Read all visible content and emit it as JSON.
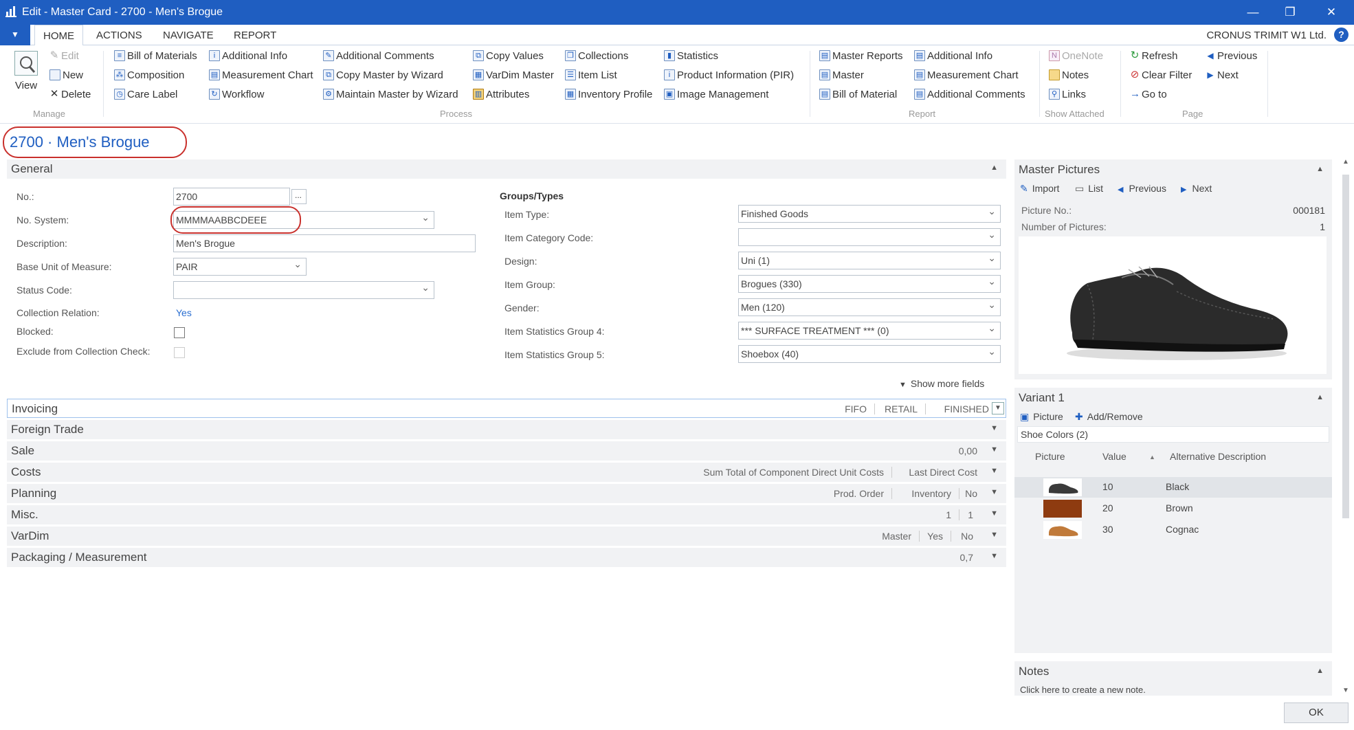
{
  "window": {
    "title": "Edit - Master Card - 2700 - Men's Brogue",
    "minimize": "—",
    "restore": "❐",
    "close": "✕"
  },
  "menu": {
    "file_glyph": "▼",
    "tabs": [
      "HOME",
      "ACTIONS",
      "NAVIGATE",
      "REPORT"
    ],
    "company": "CRONUS TRIMIT W1 Ltd.",
    "help": "?"
  },
  "ribbon": {
    "manage": {
      "view": "View",
      "edit": "Edit",
      "new": "New",
      "delete": "Delete",
      "label": "Manage"
    },
    "process": {
      "bill_of_materials": "Bill of Materials",
      "composition": "Composition",
      "care_label": "Care Label",
      "additional_info": "Additional Info",
      "measurement_chart": "Measurement Chart",
      "workflow": "Workflow",
      "additional_comments": "Additional Comments",
      "copy_master_wizard": "Copy Master by Wizard",
      "maintain_master_wizard": "Maintain Master by Wizard",
      "copy_values": "Copy Values",
      "vardim_master": "VarDim Master",
      "attributes": "Attributes",
      "collections": "Collections",
      "item_list": "Item List",
      "inventory_profile": "Inventory Profile",
      "statistics": "Statistics",
      "product_information": "Product Information (PIR)",
      "image_management": "Image Management",
      "label": "Process"
    },
    "report": {
      "master_reports": "Master Reports",
      "master": "Master",
      "bill_of_material": "Bill of Material",
      "additional_info": "Additional Info",
      "measurement_chart": "Measurement Chart",
      "additional_comments": "Additional Comments",
      "label": "Report"
    },
    "show_attached": {
      "onenote": "OneNote",
      "notes": "Notes",
      "links": "Links",
      "label": "Show Attached"
    },
    "page": {
      "refresh": "Refresh",
      "clear_filter": "Clear Filter",
      "go_to": "Go to",
      "previous": "Previous",
      "next": "Next",
      "label": "Page"
    }
  },
  "page_title": "2700 · Men's Brogue",
  "general": {
    "header": "General",
    "no_label": "No.:",
    "no_value": "2700",
    "assist": "...",
    "no_system_label": "No. System:",
    "no_system_value": "MMMMAABBCDEEE",
    "description_label": "Description:",
    "description_value": "Men's Brogue",
    "base_uom_label": "Base Unit of Measure:",
    "base_uom_value": "PAIR",
    "status_code_label": "Status Code:",
    "status_code_value": "",
    "collection_relation_label": "Collection Relation:",
    "collection_relation_value": "Yes",
    "blocked_label": "Blocked:",
    "blocked_checked": false,
    "exclude_label": "Exclude from Collection Check:",
    "exclude_checked": false,
    "groups_header": "Groups/Types",
    "item_type_label": "Item Type:",
    "item_type_value": "Finished Goods",
    "item_category_label": "Item Category Code:",
    "item_category_value": "",
    "design_label": "Design:",
    "design_value": "Uni (1)",
    "item_group_label": "Item Group:",
    "item_group_value": "Brogues (330)",
    "gender_label": "Gender:",
    "gender_value": "Men (120)",
    "stat4_label": "Item Statistics Group 4:",
    "stat4_value": "*** SURFACE TREATMENT *** (0)",
    "stat5_label": "Item Statistics Group 5:",
    "stat5_value": "Shoebox (40)",
    "show_more": "Show more fields"
  },
  "fasttabs": {
    "invoicing": {
      "label": "Invoicing",
      "v1": "FIFO",
      "v2": "RETAIL",
      "v3": "FINISHED"
    },
    "foreign_trade": {
      "label": "Foreign Trade"
    },
    "sale": {
      "label": "Sale",
      "v1": "0,00"
    },
    "costs": {
      "label": "Costs",
      "v1": "Sum Total of Component Direct Unit Costs",
      "v2": "Last Direct Cost"
    },
    "planning": {
      "label": "Planning",
      "v1": "Prod. Order",
      "v2": "Inventory",
      "v3": "No"
    },
    "misc": {
      "label": "Misc.",
      "v1": "1",
      "v2": "1"
    },
    "vardim": {
      "label": "VarDim",
      "v1": "Master",
      "v2": "Yes",
      "v3": "No"
    },
    "packaging": {
      "label": "Packaging / Measurement",
      "v1": "0,7"
    }
  },
  "master_pictures": {
    "header": "Master Pictures",
    "import": "Import",
    "list": "List",
    "previous": "Previous",
    "next": "Next",
    "picture_no_label": "Picture No.:",
    "picture_no_value": "000181",
    "number_label": "Number of Pictures:",
    "number_value": "1"
  },
  "variant": {
    "header": "Variant 1",
    "picture": "Picture",
    "add_remove": "Add/Remove",
    "group": "Shoe Colors (2)",
    "col_picture": "Picture",
    "col_value": "Value",
    "col_alt": "Alternative Description",
    "rows": [
      {
        "value": "10",
        "desc": "Black",
        "color": "#3a3a3a"
      },
      {
        "value": "20",
        "desc": "Brown",
        "color": "#8e3b10"
      },
      {
        "value": "30",
        "desc": "Cognac",
        "color": "#c07a3a"
      }
    ]
  },
  "notes": {
    "header": "Notes",
    "link": "Click here to create a new note."
  },
  "ok": "OK"
}
